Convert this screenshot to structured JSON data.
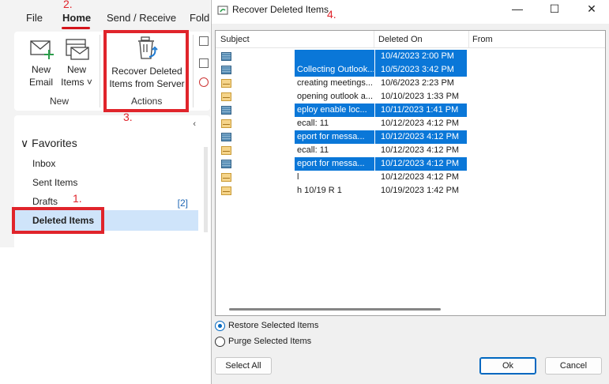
{
  "outlook": {
    "tabs": [
      {
        "label": "File",
        "active": false
      },
      {
        "label": "Home",
        "active": true
      },
      {
        "label": "Send / Receive",
        "active": false
      },
      {
        "label": "Fold",
        "active": false
      }
    ],
    "ribbon": {
      "new_email": [
        "New",
        "Email"
      ],
      "new_items": [
        "New",
        "Items ˅"
      ],
      "group_new": "New",
      "recover": [
        "Recover Deleted",
        "Items from Server"
      ],
      "group_actions": "Actions"
    },
    "folders": {
      "header": "Favorites",
      "items": [
        "Inbox",
        "Sent Items",
        "Drafts",
        "Deleted Items"
      ],
      "drafts_count": "[2]",
      "selected": "Deleted Items"
    }
  },
  "annotations": {
    "step1": "1.",
    "step2": "2.",
    "step3": "3.",
    "step4": "4."
  },
  "dialog": {
    "title": "Recover Deleted Items",
    "columns": {
      "subject": "Subject",
      "deleted_on": "Deleted On",
      "from": "From"
    },
    "rows": [
      {
        "subject": "",
        "deleted_on": "10/4/2023 2:00 PM",
        "icon": "note",
        "selected": true
      },
      {
        "subject": "Collecting Outlook...",
        "deleted_on": "10/5/2023 3:42 PM",
        "icon": "note",
        "selected": true
      },
      {
        "subject": "creating meetings...",
        "deleted_on": "10/6/2023 2:23 PM",
        "icon": "envelope",
        "selected": false
      },
      {
        "subject": "opening outlook a...",
        "deleted_on": "10/10/2023 1:33 PM",
        "icon": "envelope",
        "selected": false
      },
      {
        "subject": "eploy enable loc...",
        "deleted_on": "10/11/2023 1:41 PM",
        "icon": "note",
        "selected": true
      },
      {
        "subject": "ecall: 11",
        "deleted_on": "10/12/2023 4:12 PM",
        "icon": "envelope",
        "selected": false
      },
      {
        "subject": "eport for messa...",
        "deleted_on": "10/12/2023 4:12 PM",
        "icon": "note",
        "selected": true
      },
      {
        "subject": "ecall: 11",
        "deleted_on": "10/12/2023 4:12 PM",
        "icon": "envelope",
        "selected": false
      },
      {
        "subject": "eport for messa...",
        "deleted_on": "10/12/2023 4:12 PM",
        "icon": "note",
        "selected": true
      },
      {
        "subject": "l",
        "deleted_on": "10/12/2023 4:12 PM",
        "icon": "envelope",
        "selected": false
      },
      {
        "subject": "h 10/19 R 1",
        "deleted_on": "10/19/2023 1:42 PM",
        "icon": "envelope",
        "selected": false
      }
    ],
    "options": {
      "restore": "Restore Selected Items",
      "purge": "Purge Selected Items",
      "selected": "restore"
    },
    "buttons": {
      "select_all": "Select All",
      "ok": "Ok",
      "cancel": "Cancel"
    },
    "window_controls": {
      "minimize": "—",
      "maximize": "☐",
      "close": "✕"
    }
  },
  "colors": {
    "selection_blue": "#0a77d8",
    "annotation_red": "#e0242b",
    "folder_selected": "#cfe4fa"
  }
}
